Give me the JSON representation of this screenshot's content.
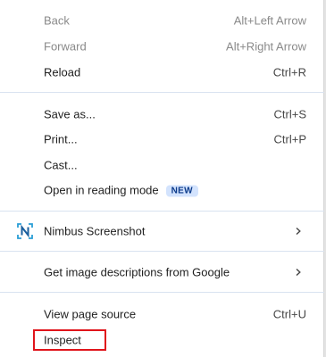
{
  "menu": {
    "back": {
      "label": "Back",
      "shortcut": "Alt+Left Arrow"
    },
    "forward": {
      "label": "Forward",
      "shortcut": "Alt+Right Arrow"
    },
    "reload": {
      "label": "Reload",
      "shortcut": "Ctrl+R"
    },
    "save_as": {
      "label": "Save as...",
      "shortcut": "Ctrl+S"
    },
    "print": {
      "label": "Print...",
      "shortcut": "Ctrl+P"
    },
    "cast": {
      "label": "Cast..."
    },
    "reading_mode": {
      "label": "Open in reading mode",
      "badge": "NEW"
    },
    "nimbus": {
      "label": "Nimbus Screenshot",
      "icon": "nimbus-screenshot-icon"
    },
    "image_descriptions": {
      "label": "Get image descriptions from Google"
    },
    "view_source": {
      "label": "View page source",
      "shortcut": "Ctrl+U"
    },
    "inspect": {
      "label": "Inspect"
    }
  },
  "colors": {
    "highlight_border": "#e0141b",
    "badge_bg": "#d3e3fd",
    "separator": "#d9e3f0",
    "nimbus_accent": "#2a9fd6"
  }
}
